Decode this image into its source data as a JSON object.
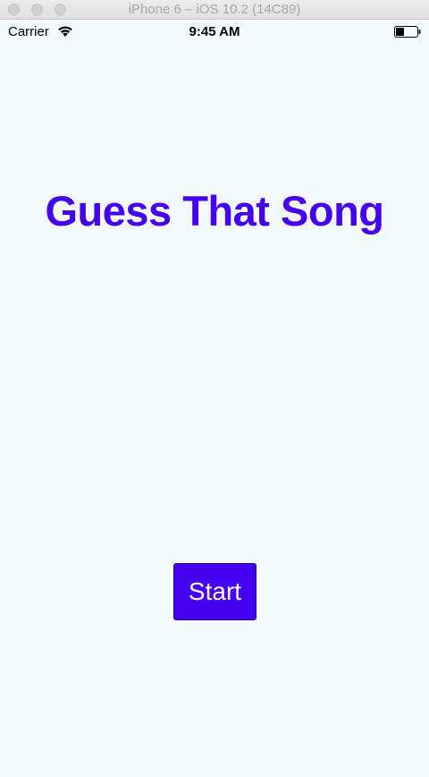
{
  "window": {
    "title": "iPhone 6 – iOS 10.2 (14C89)"
  },
  "statusbar": {
    "carrier": "Carrier",
    "time": "9:45 AM",
    "wifi_icon": "wifi-icon",
    "battery_icon": "battery-icon"
  },
  "main": {
    "title": "Guess That Song",
    "start_label": "Start"
  },
  "colors": {
    "accent": "#4600f0",
    "background": "#f2fafe",
    "button_text": "#ffffff"
  }
}
